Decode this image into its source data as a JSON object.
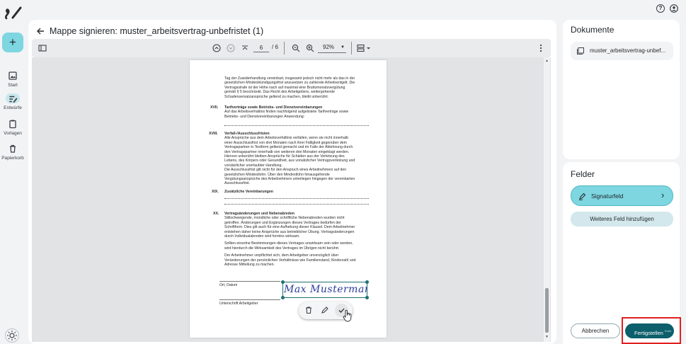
{
  "rail": {
    "new_button": "+",
    "items": [
      {
        "label": "Start",
        "icon": "image-icon"
      },
      {
        "label": "Entwürfe",
        "icon": "draft-icon"
      },
      {
        "label": "Vorlagen",
        "icon": "clipboard-icon"
      },
      {
        "label": "Papierkorb",
        "icon": "trash-icon"
      }
    ]
  },
  "header": {
    "title": "Mappe signieren: muster_arbeitsvertrag-unbefristet (1)"
  },
  "toolbar": {
    "page_current": "6",
    "page_total": "/ 6",
    "zoom": "92%"
  },
  "document": {
    "p1": [
      "Tag der Zuwiderhandlung vereinbart, insgesamt jedoch nicht mehr als das in der",
      "gesetzlichen Mindestkündigungsfrist anzusetzen zu zahlende Arbeitsentgelt. Die",
      "Vertragsstrafe ist der Höhe nach auf maximal eine Bruttomonatsvergütung",
      "gemäß § 5 beschränkt. Das Recht des Arbeitgebers, weitergehende",
      "Schadensersatzansprüche geltend zu machen, bleibt unberührt."
    ],
    "s17_num": "XVII.",
    "s17_title": "Tarifverträge sowie Betriebs- und Dienstvereinbarungen",
    "s17_body": [
      "Auf das Arbeitsverhältnis finden nachfolgend aufgelistete Tarifverträge sowie",
      "Betriebs- und Dienstvereinbarungen Anwendung:"
    ],
    "s18_num": "XVIII.",
    "s18_title": "Verfall-/Ausschlussfristen",
    "s18_body": [
      "Alle Ansprüche aus dem Arbeitsverhältnis verfallen, wenn sie nicht innerhalb",
      "einer Ausschlussfrist von drei Monaten nach ihrer Fälligkeit gegenüber dem",
      "Vertragspartner in Textform geltend gemacht und im Falle der Ablehnung durch",
      "den Vertragspartner innerhalb von weiteren drei Monaten eingeklagt werden.",
      "Hiervon unberührt bleiben Ansprüche für Schäden aus der Verletzung des",
      "Lebens, des Körpers oder Gesundheit, aus vorsätzlicher Vertragsverletzung und",
      "vorsätzlicher unerlaubter Handlung.",
      "Die Ausschlussfrist gilt nicht für den Anspruch eines Arbeitnehmers auf den",
      "gesetzlichen Mindestlohn. Über den Mindestlohn hinausgehende",
      "Vergütungsansprüche des Arbeitnehmers unterliegen hingegen der vereinbarten",
      "Ausschlussfrist."
    ],
    "s19_num": "XIX.",
    "s19_title": "Zusätzliche Vereinbarungen",
    "s20_num": "XX.",
    "s20_title": "Vertragsänderungen und Nebenabreden",
    "s20_body": [
      "Stillschweigende, mündliche oder schriftliche Nebenabreden wurden nicht",
      "getroffen. Änderungen und Ergänzungen dieses Vertrages bedürfen der",
      "Schriftform. Dies gilt auch für eine Aufhebung dieser Klausel. Dem Arbeitnehmer",
      "entstehen daher keine Ansprüche aus betrieblicher Übung. Vertragsänderungen",
      "durch Individualabreden sind formlos wirksam."
    ],
    "s20_body2": [
      "Sollten einzelne Bestimmungen dieses Vertrages unwirksam sein oder werden,",
      "wird hierdurch die Wirksamkeit des Vertrages im Übrigen nicht berührt."
    ],
    "s20_body3": [
      "Der Arbeitnehmer verpflichtet sich, dem Arbeitgeber unverzüglich über",
      "Veränderungen der persönlichen Verhältnisse wie Familienstand, Kinderzahl und",
      "Adresse Mitteilung zu machen."
    ],
    "place_date": "Ort, Datum",
    "employer_sig": "Unterschrift Arbeitgeber",
    "signature_text": "Max Mustermann"
  },
  "panel": {
    "documents_title": "Dokumente",
    "document_item": "muster_arbeitsvertrag-unbef...",
    "fields_title": "Felder",
    "signature_field": "Signaturfeld",
    "add_field": "Weiteres Feld hinzufügen",
    "cancel": "Abbrechen",
    "finish": "Fertigstellen",
    "finish_hint": "Enter"
  },
  "colors": {
    "accent": "#7dd6e0",
    "primary_dark": "#0c5f6b",
    "highlight": "#e02020"
  }
}
